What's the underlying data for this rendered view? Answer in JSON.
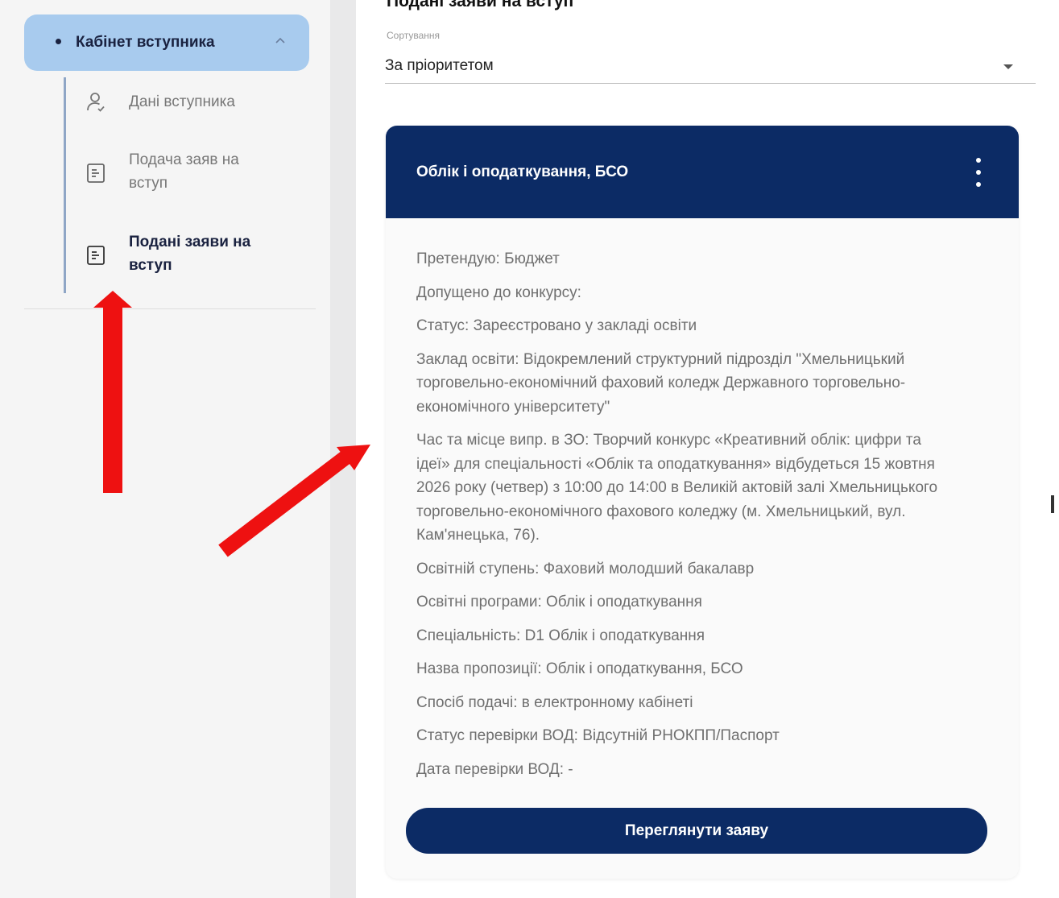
{
  "sidebar": {
    "header": {
      "label": "Кабінет вступника",
      "expanded": true
    },
    "items": [
      {
        "label": "Дані вступника",
        "icon": "person-icon",
        "active": false
      },
      {
        "label": "Подача заяв на вступ",
        "icon": "document-icon",
        "active": false
      },
      {
        "label": "Подані заяви на вступ",
        "icon": "document-icon",
        "active": true
      }
    ]
  },
  "main": {
    "title": "Подані заяви на вступ",
    "sort": {
      "label": "Сортування",
      "value": "За пріоритетом"
    },
    "card": {
      "title": "Облік і оподаткування, БСО",
      "lines": [
        "Претендую: Бюджет",
        "Допущено до конкурсу:",
        "Статус: Зареєстровано у закладі освіти",
        "Заклад освіти: Відокремлений структурний підрозділ \"Хмельницький торговельно-економічний фаховий коледж Державного торговельно-економічного університету\"",
        "Час та місце випр. в ЗО: Творчий конкурс «Креативний облік: цифри та ідеї» для спеціальності «Облік та оподаткування» відбудеться 15 жовтня 2026 року (четвер) з 10:00 до 14:00 в Великій актовій залі Хмельницького торговельно-економічного фахового коледжу (м. Хмельницький, вул. Кам'янецька, 76).",
        "Освітній ступень: Фаховий молодший бакалавр",
        "Освітні програми: Облік і оподаткування",
        "Спеціальність: D1 Облік і оподаткування",
        "Назва пропозиції: Облік і оподаткування, БСО",
        "Спосіб подачі: в електронному кабінеті",
        "Статус перевірки ВОД: Відсутній РНОКПП/Паспорт",
        "Дата перевірки ВОД: -"
      ],
      "button_label": "Переглянути заяву"
    }
  },
  "colors": {
    "primary_dark": "#0c2b65",
    "sidebar_active": "#a8cbee",
    "annotation_arrow": "#ee1111"
  }
}
